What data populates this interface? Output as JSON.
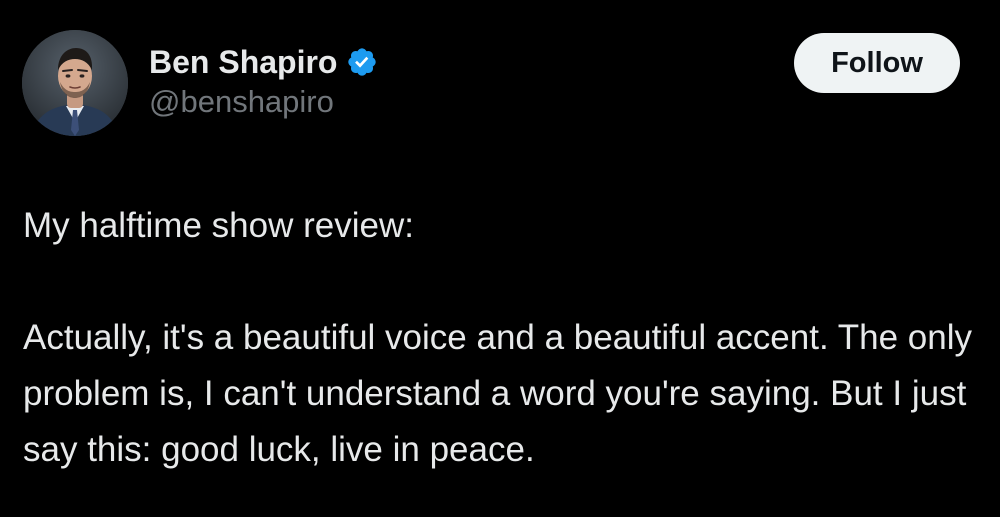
{
  "author": {
    "display_name": "Ben Shapiro",
    "handle": "@benshapiro",
    "verified": true,
    "avatar_icon": "user-photo-avatar"
  },
  "actions": {
    "follow_label": "Follow"
  },
  "tweet": {
    "paragraph_1": "My halftime show review:",
    "paragraph_2": "Actually, it's a beautiful voice and a beautiful accent. The only problem is, I can't understand a word you're saying. But I just say this: good luck, live in peace."
  },
  "colors": {
    "background": "#000000",
    "text_primary": "#e7e9ea",
    "text_secondary": "#71767b",
    "verified_badge": "#1d9bf0",
    "follow_button_bg": "#eff3f4",
    "follow_button_text": "#0f1419"
  }
}
